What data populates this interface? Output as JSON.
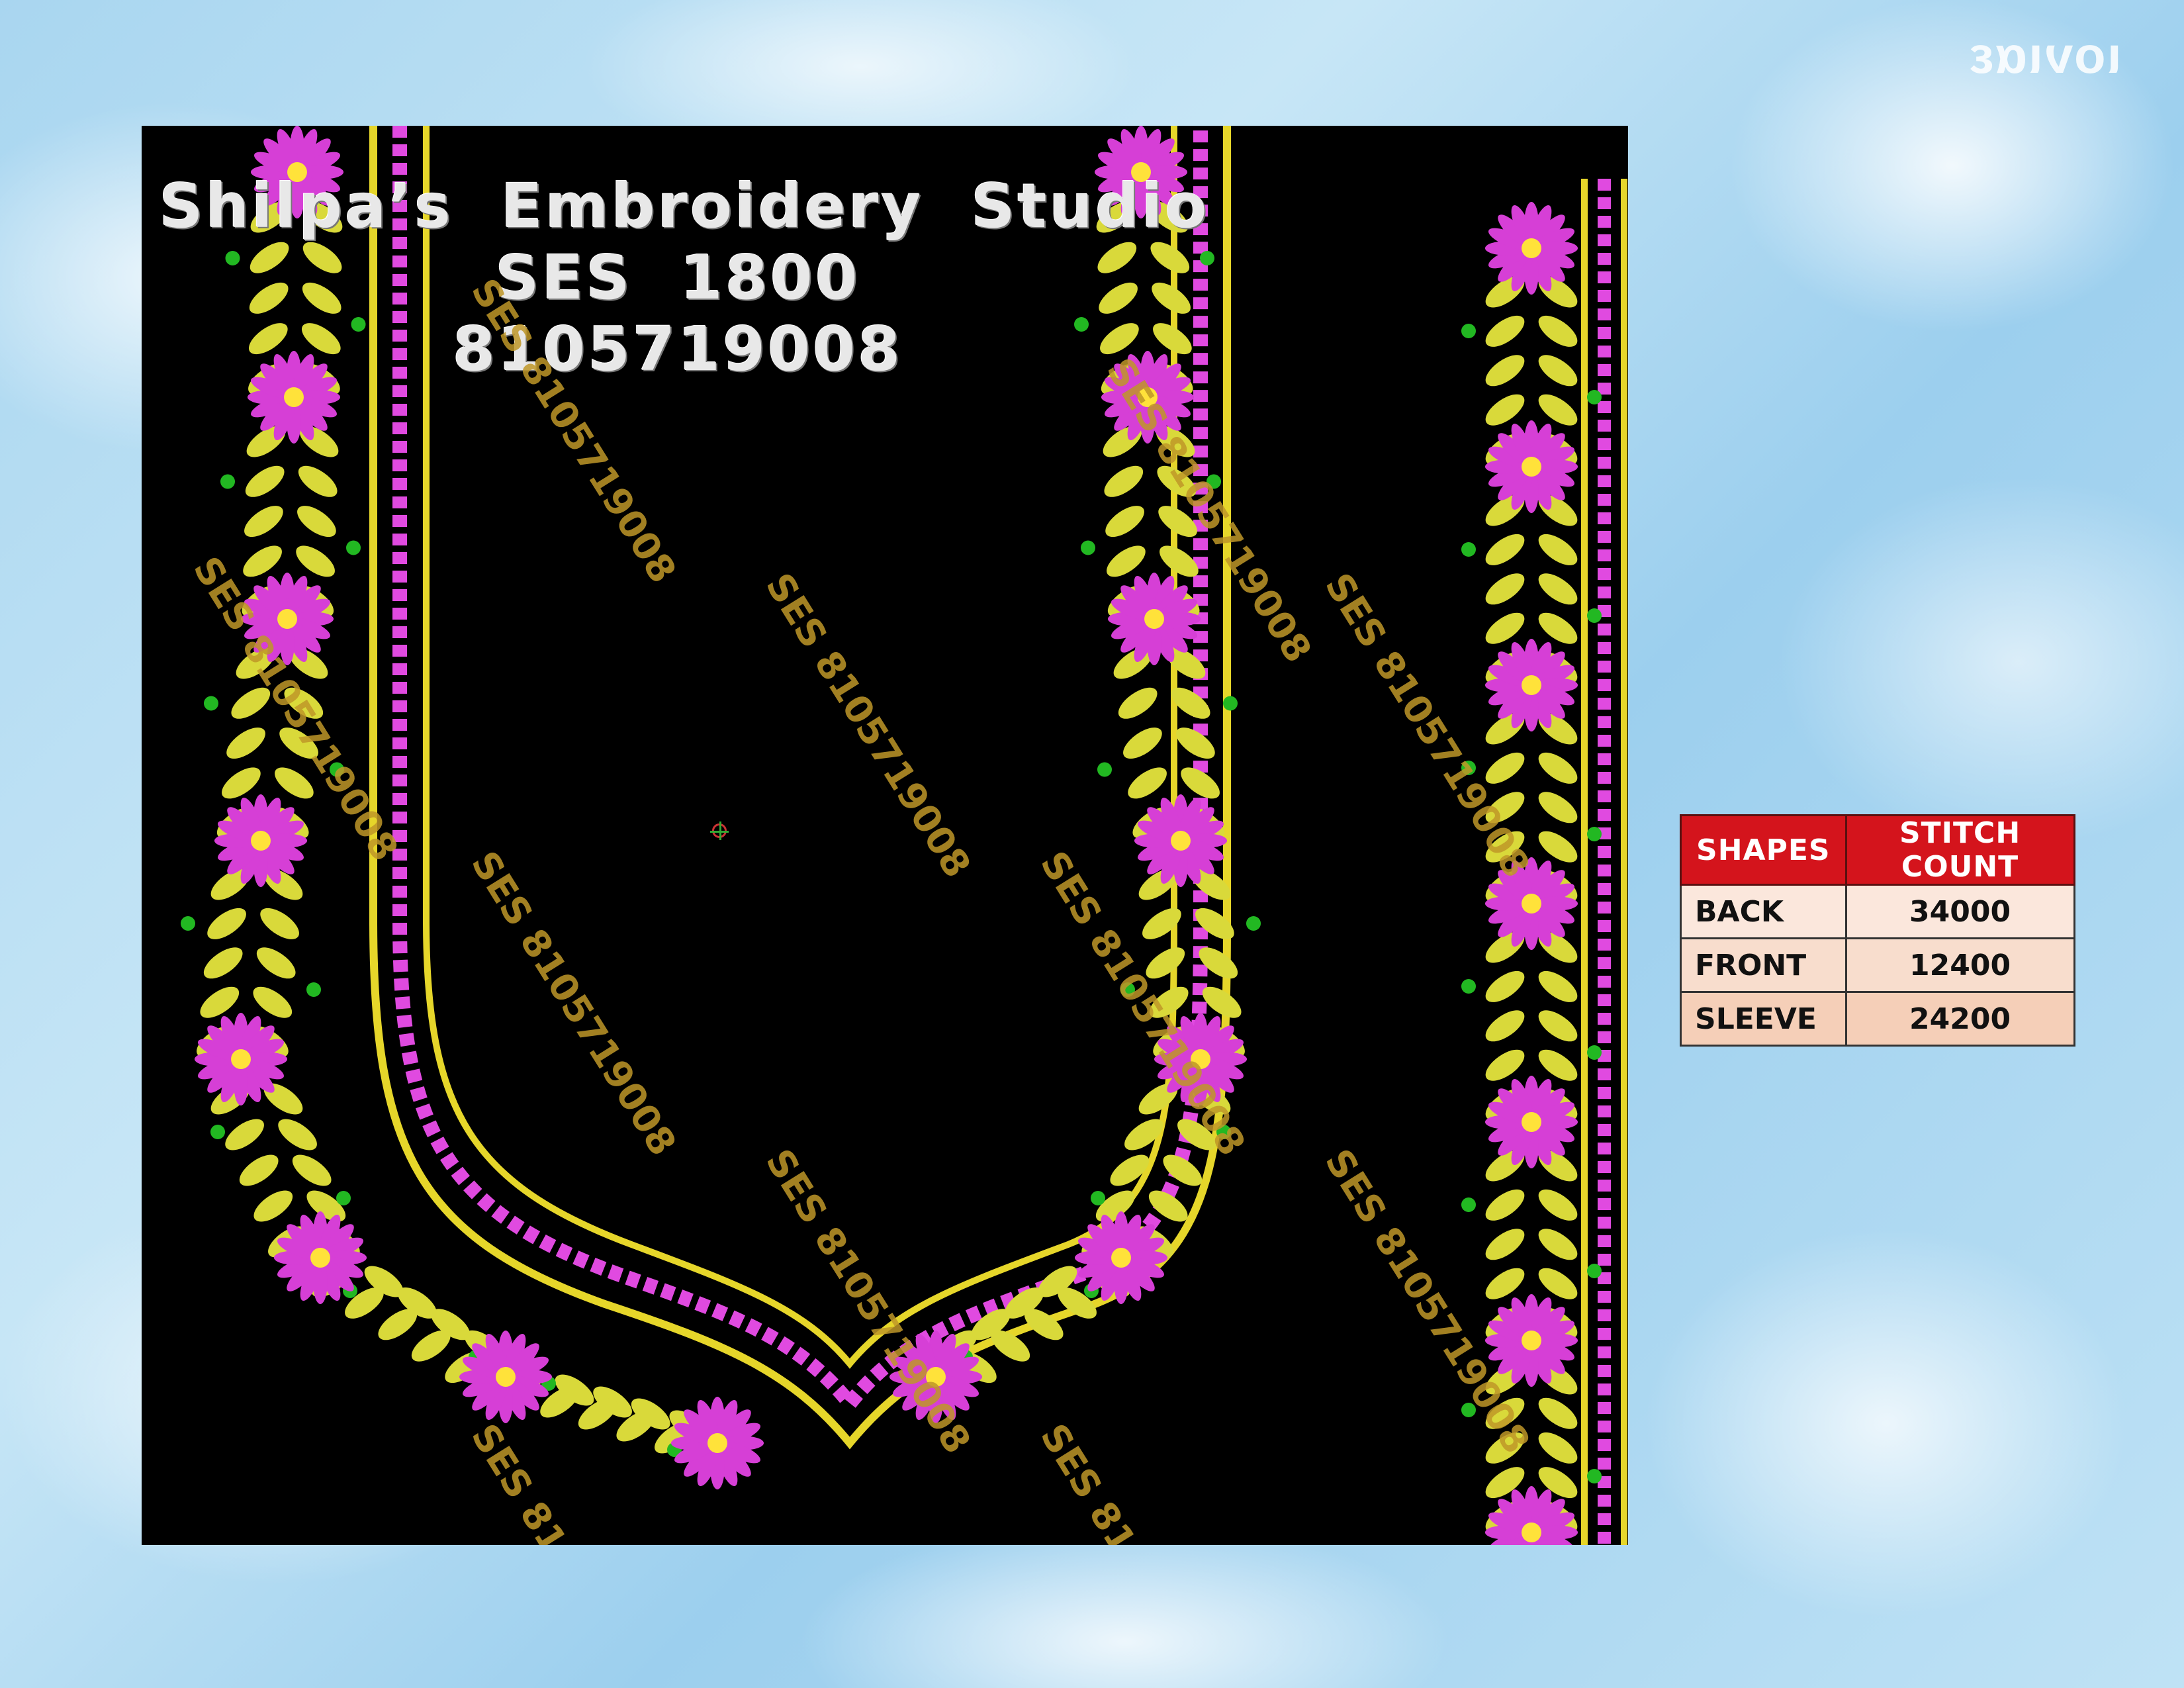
{
  "top_watermark": "ιονιαε",
  "design": {
    "studio_name": "Shilpa’s  Embroidery  Studio",
    "design_code": "SES  1800",
    "phone": "8105719008",
    "watermark_text": "SES 8105719008",
    "colors": {
      "background": "#000000",
      "flower": "#d63fd6",
      "flower_center": "#ffe23a",
      "leaf": "#d9d93a",
      "border_line": "#e6d62a",
      "diamond": "#e04ae0",
      "dot": "#22b822"
    }
  },
  "table": {
    "headers": [
      "SHAPES",
      "STITCH COUNT"
    ],
    "rows": [
      {
        "shape": "BACK",
        "count": "34000"
      },
      {
        "shape": "FRONT",
        "count": "12400"
      },
      {
        "shape": "SLEEVE",
        "count": "24200"
      }
    ]
  }
}
